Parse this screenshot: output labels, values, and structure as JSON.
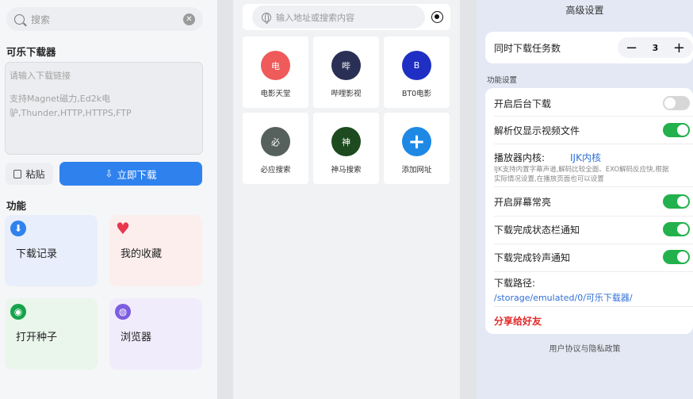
{
  "panel1": {
    "search_placeholder": "搜索",
    "section_title": "可乐下载器",
    "input_placeholder": "请输入下载链接",
    "input_hint": "支持Magnet磁力,Ed2k电驴,Thunder,HTTP,HTTPS,FTP",
    "paste_label": "粘贴",
    "download_label": "立即下载",
    "features_title": "功能",
    "cards": [
      {
        "label": "下载记录",
        "icon": "download-icon",
        "color": "#2f82ee"
      },
      {
        "label": "我的收藏",
        "icon": "heart-icon",
        "color": "#e8384f"
      },
      {
        "label": "打开种子",
        "icon": "eye-icon",
        "color": "#16a34a"
      },
      {
        "label": "浏览器",
        "icon": "globe-icon",
        "color": "#7c5ce0"
      }
    ]
  },
  "panel2": {
    "url_placeholder": "输入地址或搜索内容",
    "sites": [
      {
        "label": "电影天堂",
        "glyph": "电",
        "color": "#ef5a5a"
      },
      {
        "label": "哔哩影视",
        "glyph": "哔",
        "color": "#2a2f55"
      },
      {
        "label": "BT0电影",
        "glyph": "B",
        "color": "#1f2fc4"
      },
      {
        "label": "必应搜索",
        "glyph": "必",
        "color": "#56605c"
      },
      {
        "label": "神马搜索",
        "glyph": "神",
        "color": "#1d4a1e"
      },
      {
        "label": "添加网址",
        "glyph": "+",
        "color": "#1e88e5"
      }
    ]
  },
  "panel3": {
    "title": "高级设置",
    "concurrent_label": "同时下载任务数",
    "concurrent_value": "3",
    "section_label": "功能设置",
    "bg_download": "开启后台下载",
    "bg_download_on": false,
    "video_only": "解析仅显示视频文件",
    "video_only_on": true,
    "player_label": "播放器内核:",
    "player_value": "IJK内核",
    "player_desc": "IJK支持内置字幕声道,解码比较全面、EXO解码反应快,根据实际情况设置,在播放页面也可以设置",
    "screen_on": "开启屏幕常亮",
    "screen_on_on": true,
    "notify_status": "下载完成状态栏通知",
    "notify_status_on": true,
    "notify_sound": "下载完成铃声通知",
    "notify_sound_on": true,
    "path_label": "下载路径:",
    "path_value": "/storage/emulated/0/可乐下载器/",
    "share_label": "分享给好友",
    "footer": "用户协议与隐私政策"
  }
}
